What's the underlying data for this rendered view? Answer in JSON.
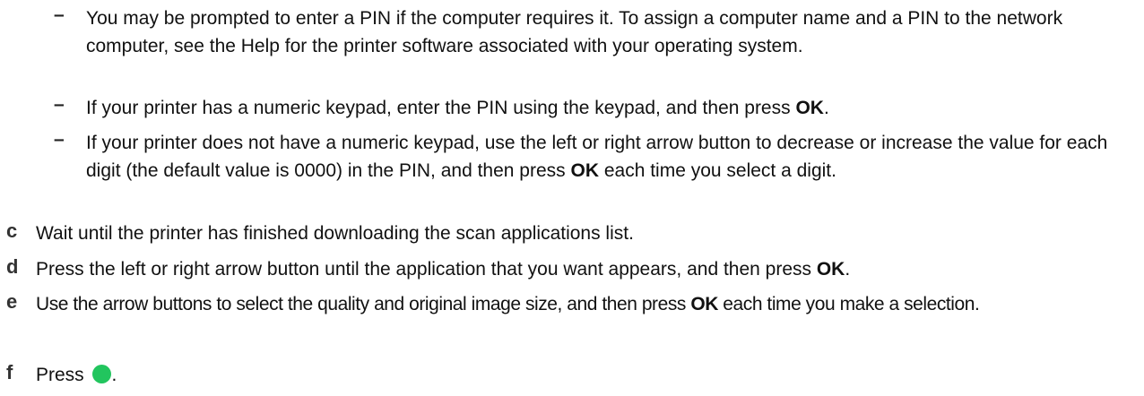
{
  "colors": {
    "text": "#111111",
    "start_button": "#22c55e"
  },
  "sub_items": [
    {
      "marker": "–",
      "text": "You may be prompted to enter a PIN if the computer requires it. To assign a computer name and a PIN to the network computer, see the Help for the printer software associated with your operating system."
    },
    {
      "marker": "–",
      "text_before": "If your printer has a numeric keypad, enter the PIN using the keypad, and then press ",
      "bold": "OK",
      "text_after": "."
    },
    {
      "marker": "–",
      "text_before": "If your printer does not have a numeric keypad, use the left or right arrow button to decrease or increase the value for each digit (the default value is 0000) in the PIN, and then press ",
      "bold": "OK",
      "text_after": " each time you select a digit."
    }
  ],
  "steps": [
    {
      "letter": "c",
      "text": "Wait until the printer has finished downloading the scan applications list."
    },
    {
      "letter": "d",
      "text_before": "Press the left or right arrow button until the application that you want appears, and then press ",
      "bold": "OK",
      "text_after": "."
    },
    {
      "letter": "e",
      "text_before": "Use the arrow buttons to select the quality and original image size, and then press ",
      "bold": "OK",
      "text_after": " each time you make a selection."
    },
    {
      "letter": "f",
      "text_before": "Press",
      "icon": "green-start-button-icon",
      "text_after": "."
    }
  ]
}
